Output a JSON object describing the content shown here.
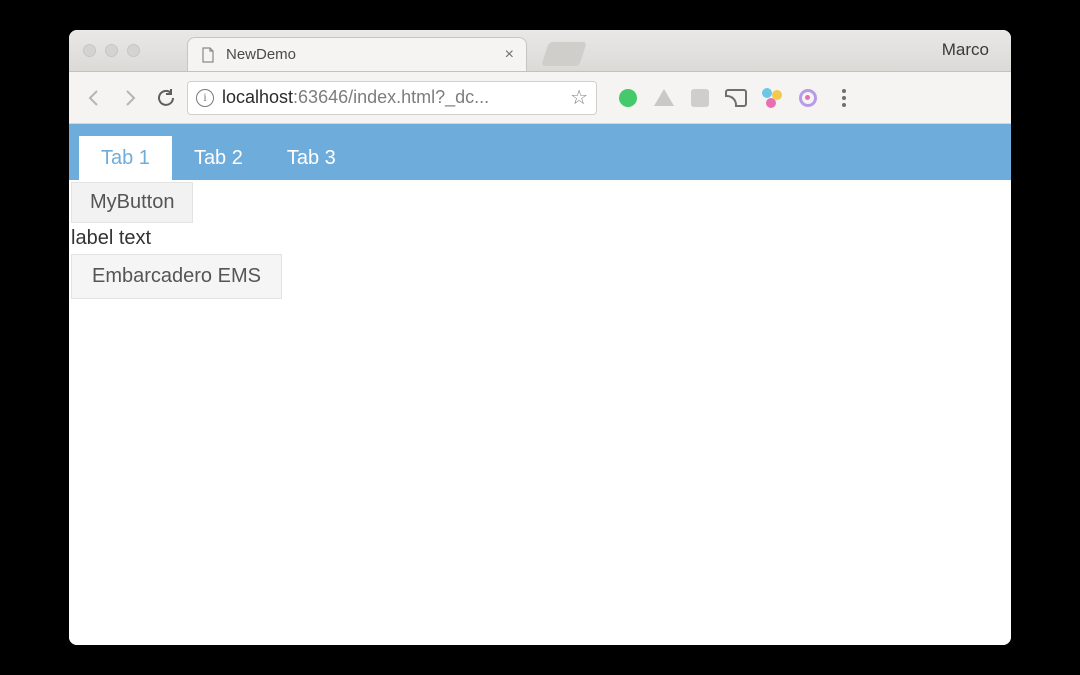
{
  "browser": {
    "profile_name": "Marco",
    "tab_title": "NewDemo",
    "url_host": "localhost",
    "url_port": ":63646",
    "url_path": "/index.html?_dc...",
    "close_glyph": "×",
    "star_glyph": "☆"
  },
  "app": {
    "tabs": [
      {
        "label": "Tab 1",
        "active": true
      },
      {
        "label": "Tab 2",
        "active": false
      },
      {
        "label": "Tab 3",
        "active": false
      }
    ],
    "button1_label": "MyButton",
    "label_text": "label text",
    "button2_label": "Embarcadero EMS"
  }
}
